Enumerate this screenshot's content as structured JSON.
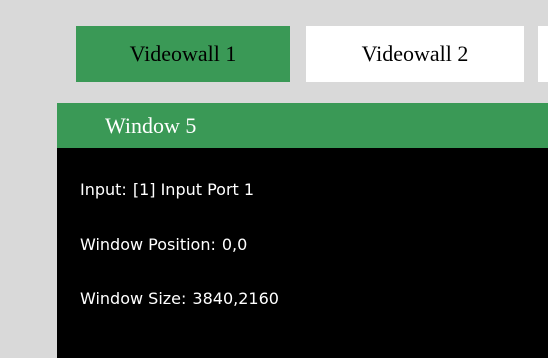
{
  "tabs": [
    {
      "label": "Videowall 1",
      "active": true
    },
    {
      "label": "Videowall 2",
      "active": false
    }
  ],
  "window": {
    "title": "Window 5",
    "input_label": "Input:",
    "input_value": "[1] Input Port 1",
    "position_label": "Window Position:",
    "position_value": "0,0",
    "size_label": "Window Size:",
    "size_value": "3840,2160"
  },
  "colors": {
    "accent": "#3a9956",
    "background": "#d9d9d9",
    "panel": "#000000",
    "tab_inactive": "#ffffff"
  }
}
